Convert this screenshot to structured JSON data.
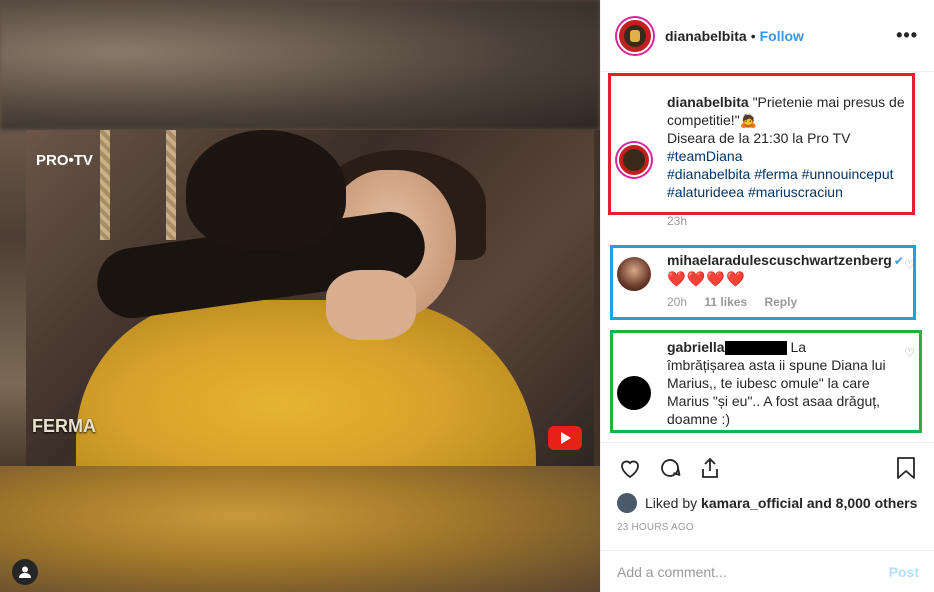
{
  "video": {
    "channel_logo": "PRO•TV",
    "show_logo": "FERMA",
    "play_icon": "youtube-play-icon"
  },
  "header": {
    "username": "dianabelbita",
    "separator": "•",
    "follow_label": "Follow",
    "more_icon": "•••"
  },
  "caption": {
    "username": "dianabelbita",
    "line1": "\"Prietenie mai presus de competitie!\"",
    "emoji": "🙇",
    "line2": "Diseara de la 21:30 la Pro TV",
    "tags": [
      "#teamDiana",
      "#dianabelbita",
      "#ferma",
      "#unnouinceput",
      "#alaturideea",
      "#mariuscraciun"
    ],
    "time": "23h"
  },
  "comments": [
    {
      "username": "mihaelaradulescuschwartzenberg",
      "text": "❤️❤️❤️❤️",
      "time": "20h",
      "likes": "11 likes",
      "reply": "Reply"
    },
    {
      "username": "gabriella",
      "text": " La îmbrățișarea asta ii spune Diana lui Marius,, te iubesc omule\" la care Marius \"și eu\".. A fost asaa drăguț, doamne :)"
    }
  ],
  "actions": {
    "liked_by_prefix": "Liked by",
    "liked_by_user": "kamara_official",
    "liked_by_suffix": "and 8,000 others",
    "timestamp": "23 HOURS AGO"
  },
  "add_comment": {
    "placeholder": "Add a comment...",
    "post_label": "Post"
  },
  "colors": {
    "follow": "#3897f0",
    "hashtag": "#003569",
    "annotation_red": "#e21f2d",
    "annotation_blue": "#1da1e6",
    "annotation_green": "#21ad4a"
  }
}
